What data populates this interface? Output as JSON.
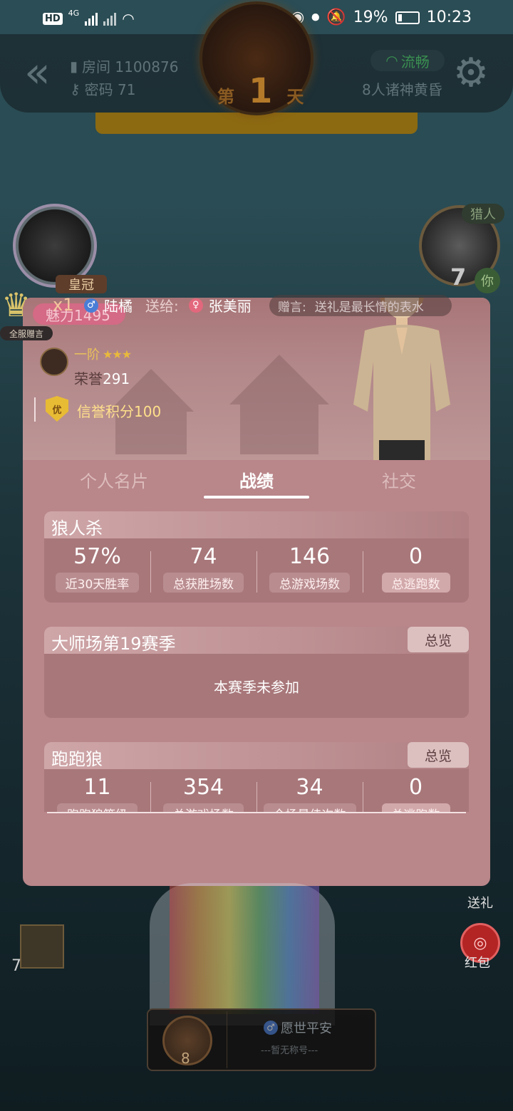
{
  "status_bar": {
    "left_indicators": [
      "HD",
      "4G"
    ],
    "battery": "19%",
    "time": "10:23"
  },
  "room": {
    "room_label": "房间 1100876",
    "password_label": "密码 71",
    "day_prefix": "第",
    "day_number": "1",
    "day_suffix": "天",
    "network": "流畅",
    "mode": "8人诸神黄昏"
  },
  "players": {
    "right_role": "猎人",
    "right_seat": "7",
    "you": "你",
    "bottom_left_seat": "7",
    "bottom_center_seat": "8",
    "bottom_center_name": "愿世平安",
    "bottom_center_title": "---暂无称号---"
  },
  "gift": {
    "badge": "皇冠",
    "count": "x1",
    "sender": "陆橘",
    "to_label": "送给:",
    "receiver": "张美丽",
    "message_label": "赠言:",
    "message": "送礼是最长情的表水",
    "global_tag": "全服赠言"
  },
  "profile": {
    "charm": "魅力1495",
    "rank": "一阶",
    "stars": "★★★",
    "honor_label": "荣誉",
    "honor_value": "291",
    "credit_badge": "优",
    "credit": "信誉积分100"
  },
  "tabs": [
    {
      "label": "个人名片",
      "active": false
    },
    {
      "label": "战绩",
      "active": true
    },
    {
      "label": "社交",
      "active": false
    }
  ],
  "sections": {
    "werewolf": {
      "title": "狼人杀",
      "stats": [
        {
          "value": "57%",
          "label": "近30天胜率"
        },
        {
          "value": "74",
          "label": "总获胜场数"
        },
        {
          "value": "146",
          "label": "总游戏场数"
        },
        {
          "value": "0",
          "label": "总逃跑数"
        }
      ]
    },
    "master": {
      "title": "大师场第19赛季",
      "overview": "总览",
      "note": "本赛季未参加"
    },
    "runwolf": {
      "title": "跑跑狼",
      "overview": "总览",
      "stats": [
        {
          "value": "11",
          "label": "跑跑狼等级"
        },
        {
          "value": "354",
          "label": "总游戏场数"
        },
        {
          "value": "34",
          "label": "全场最佳次数"
        },
        {
          "value": "0",
          "label": "总逃跑数"
        }
      ]
    }
  },
  "side_buttons": {
    "gift": "送礼",
    "red_packet": "红包"
  },
  "colors": {
    "modal_bg": "#b9868a",
    "accent_gold": "#e9c15a",
    "network_green": "#3a8f51"
  }
}
